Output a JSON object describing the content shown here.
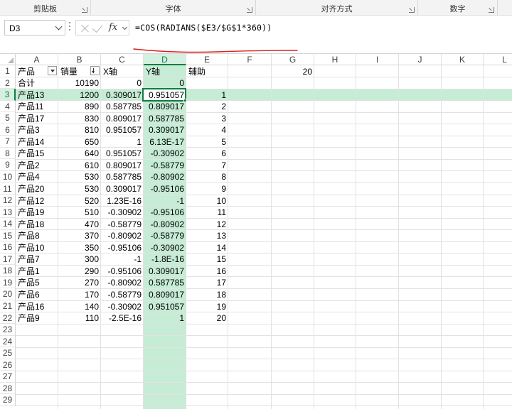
{
  "ribbon": {
    "groups": [
      {
        "label": "剪贴板"
      },
      {
        "label": "字体"
      },
      {
        "label": "对齐方式"
      },
      {
        "label": "数字"
      }
    ]
  },
  "formula_bar": {
    "name_box": "D3",
    "fx": "fx",
    "formula": "=COS(RADIANS($E3/$G$1*360))",
    "annotation_color": "#d9201c"
  },
  "accent_color": "#107c41",
  "selection_fill": "#c6ecd5",
  "columns": [
    "A",
    "B",
    "C",
    "D",
    "E",
    "F",
    "G",
    "H",
    "I",
    "J",
    "K",
    "L"
  ],
  "row_numbers": [
    "1",
    "2",
    "3",
    "4",
    "5",
    "6",
    "7",
    "8",
    "9",
    "10",
    "11",
    "12",
    "13",
    "14",
    "15",
    "16",
    "17",
    "18",
    "19",
    "20",
    "21",
    "22",
    "23",
    "24",
    "25",
    "26",
    "27",
    "28",
    "29"
  ],
  "selected_cell": {
    "column": "D",
    "row": "3"
  },
  "headers": {
    "a": "产品",
    "b": "销量",
    "c": "X轴",
    "d": "Y轴",
    "e": "辅助",
    "g": "20"
  },
  "rows": [
    {
      "a": "合计",
      "b": "10190",
      "c": "0",
      "d": "0",
      "e": ""
    },
    {
      "a": "产品13",
      "b": "1200",
      "c": "0.309017",
      "d": "0.951057",
      "e": "1"
    },
    {
      "a": "产品11",
      "b": "890",
      "c": "0.587785",
      "d": "0.809017",
      "e": "2"
    },
    {
      "a": "产品17",
      "b": "830",
      "c": "0.809017",
      "d": "0.587785",
      "e": "3"
    },
    {
      "a": "产品3",
      "b": "810",
      "c": "0.951057",
      "d": "0.309017",
      "e": "4"
    },
    {
      "a": "产品14",
      "b": "650",
      "c": "1",
      "d": "6.13E-17",
      "e": "5"
    },
    {
      "a": "产品15",
      "b": "640",
      "c": "0.951057",
      "d": "-0.30902",
      "e": "6"
    },
    {
      "a": "产品2",
      "b": "610",
      "c": "0.809017",
      "d": "-0.58779",
      "e": "7"
    },
    {
      "a": "产品4",
      "b": "530",
      "c": "0.587785",
      "d": "-0.80902",
      "e": "8"
    },
    {
      "a": "产品20",
      "b": "530",
      "c": "0.309017",
      "d": "-0.95106",
      "e": "9"
    },
    {
      "a": "产品12",
      "b": "520",
      "c": "1.23E-16",
      "d": "-1",
      "e": "10"
    },
    {
      "a": "产品19",
      "b": "510",
      "c": "-0.30902",
      "d": "-0.95106",
      "e": "11"
    },
    {
      "a": "产品18",
      "b": "470",
      "c": "-0.58779",
      "d": "-0.80902",
      "e": "12"
    },
    {
      "a": "产品8",
      "b": "370",
      "c": "-0.80902",
      "d": "-0.58779",
      "e": "13"
    },
    {
      "a": "产品10",
      "b": "350",
      "c": "-0.95106",
      "d": "-0.30902",
      "e": "14"
    },
    {
      "a": "产品7",
      "b": "300",
      "c": "-1",
      "d": "-1.8E-16",
      "e": "15"
    },
    {
      "a": "产品1",
      "b": "290",
      "c": "-0.95106",
      "d": "0.309017",
      "e": "16"
    },
    {
      "a": "产品5",
      "b": "270",
      "c": "-0.80902",
      "d": "0.587785",
      "e": "17"
    },
    {
      "a": "产品6",
      "b": "170",
      "c": "-0.58779",
      "d": "0.809017",
      "e": "18"
    },
    {
      "a": "产品16",
      "b": "140",
      "c": "-0.30902",
      "d": "0.951057",
      "e": "19"
    },
    {
      "a": "产品9",
      "b": "110",
      "c": "-2.5E-16",
      "d": "1",
      "e": "20"
    }
  ]
}
